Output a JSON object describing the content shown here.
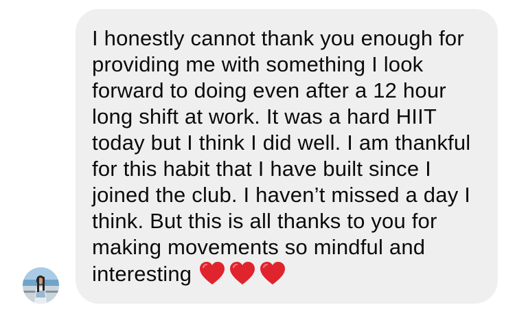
{
  "message": {
    "lines": [
      "I honestly cannot thank you enough for",
      "providing me with something I look",
      "forward to doing even after a 12 hour",
      "long shift at work. It was a hard HIIT",
      "today but I think I did well. I am thankful",
      "for this habit that I have built since I",
      "joined the club. I haven’t missed a day I",
      "think. But this is all thanks to you for",
      "making movements so mindful and",
      "interesting"
    ],
    "emoji": [
      "heart-icon",
      "heart-icon",
      "heart-icon"
    ]
  },
  "sender": {
    "avatar_icon": "avatar"
  },
  "colors": {
    "bubble": "#efefef",
    "text": "#0b0b0b",
    "heart": "#e0242d"
  }
}
